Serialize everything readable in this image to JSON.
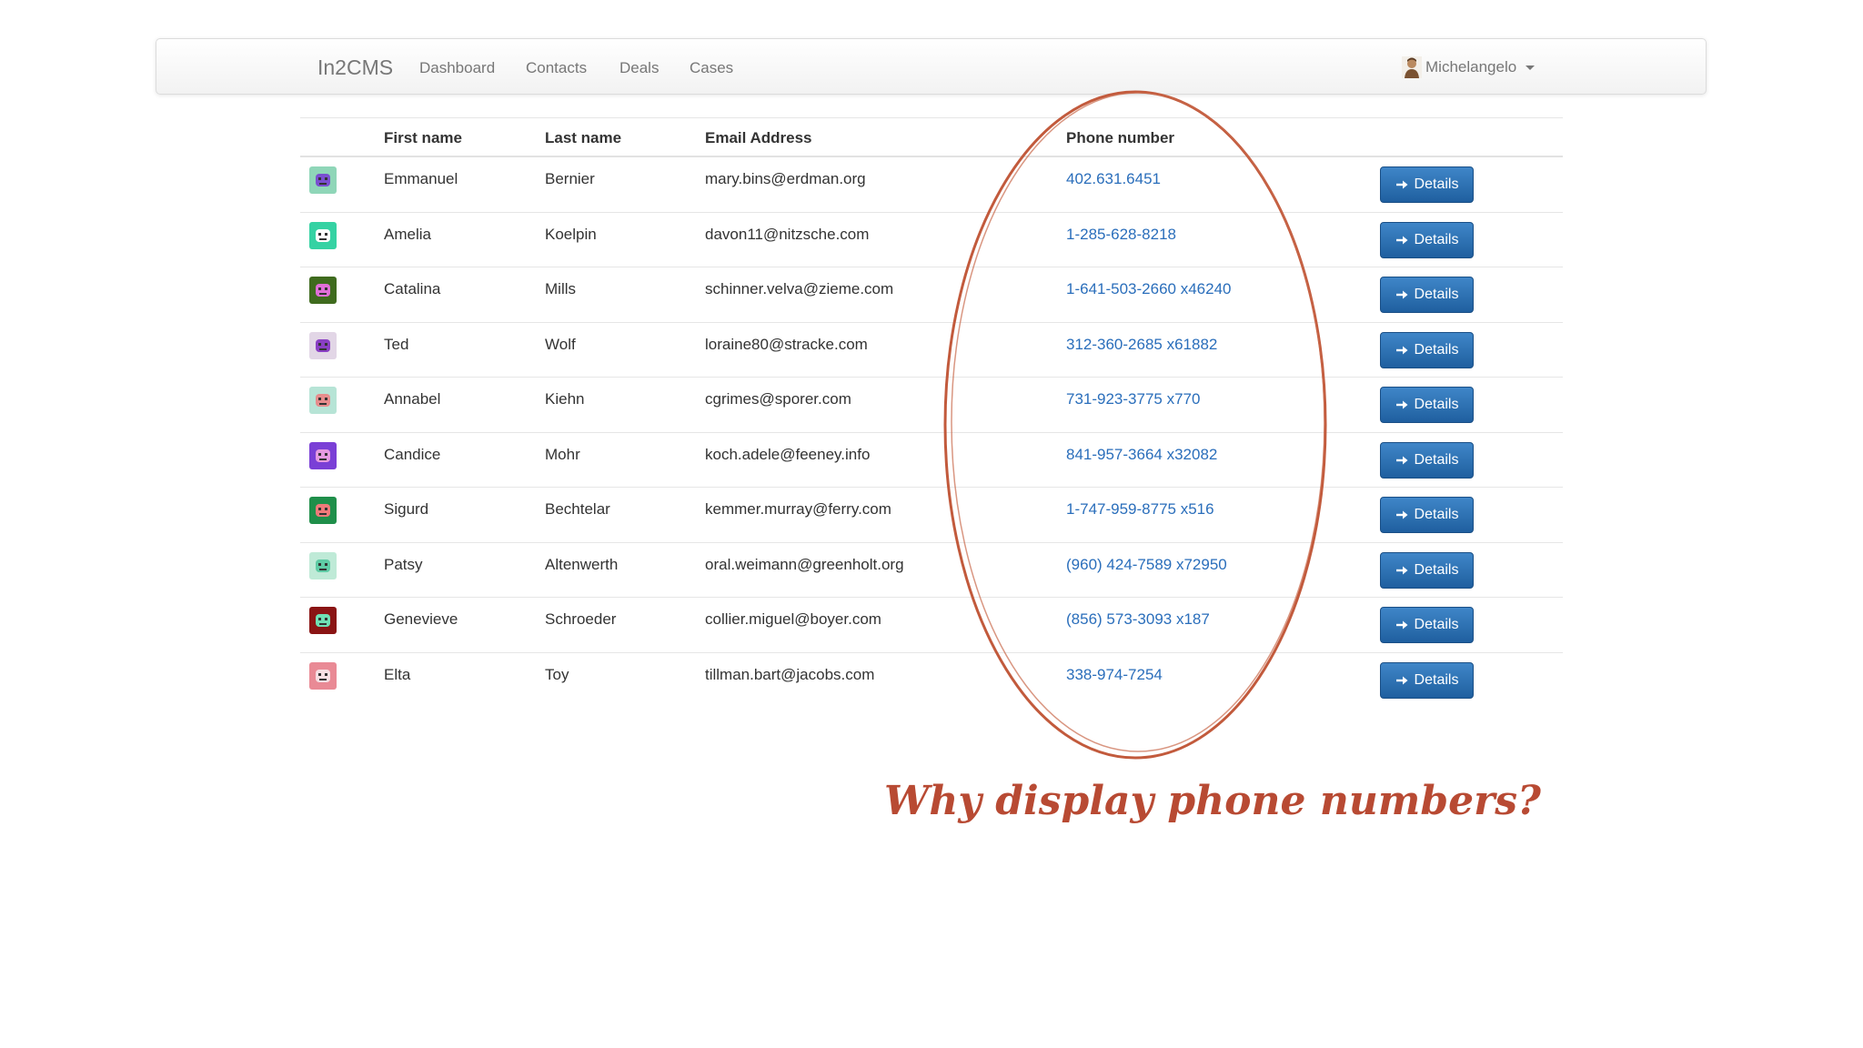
{
  "navbar": {
    "brand": "In2CMS",
    "links": [
      "Dashboard",
      "Contacts",
      "Deals",
      "Cases"
    ],
    "user": {
      "name": "Michelangelo",
      "avatar_icon": "user-avatar-icon",
      "menu_icon": "caret-down-icon"
    }
  },
  "table": {
    "headers": {
      "first_name": "First name",
      "last_name": "Last name",
      "email": "Email Address",
      "phone": "Phone number"
    },
    "details_label": "Details",
    "details_icon": "arrow-right-icon",
    "rows": [
      {
        "first": "Emmanuel",
        "last": "Bernier",
        "email": "mary.bins@erdman.org",
        "phone": "402.631.6451",
        "avatar_bg": "#8fd6b8",
        "avatar_fg": "#7a4fd0"
      },
      {
        "first": "Amelia",
        "last": "Koelpin",
        "email": "davon11@nitzsche.com",
        "phone": "1-285-628-8218",
        "avatar_bg": "#35d2a3",
        "avatar_fg": "#ffffff"
      },
      {
        "first": "Catalina",
        "last": "Mills",
        "email": "schinner.velva@zieme.com",
        "phone": "1-641-503-2660 x46240",
        "avatar_bg": "#3f6b1e",
        "avatar_fg": "#e06fd8"
      },
      {
        "first": "Ted",
        "last": "Wolf",
        "email": "loraine80@stracke.com",
        "phone": "312-360-2685 x61882",
        "avatar_bg": "#e2d6e6",
        "avatar_fg": "#8a3fc4"
      },
      {
        "first": "Annabel",
        "last": "Kiehn",
        "email": "cgrimes@sporer.com",
        "phone": "731-923-3775 x770",
        "avatar_bg": "#b7e4d6",
        "avatar_fg": "#e68d8d"
      },
      {
        "first": "Candice",
        "last": "Mohr",
        "email": "koch.adele@feeney.info",
        "phone": "841-957-3664 x32082",
        "avatar_bg": "#7a3fd6",
        "avatar_fg": "#e59ae0"
      },
      {
        "first": "Sigurd",
        "last": "Bechtelar",
        "email": "kemmer.murray@ferry.com",
        "phone": "1-747-959-8775 x516",
        "avatar_bg": "#1f8f4a",
        "avatar_fg": "#f07a7a"
      },
      {
        "first": "Patsy",
        "last": "Altenwerth",
        "email": "oral.weimann@greenholt.org",
        "phone": "(960) 424-7589 x72950",
        "avatar_bg": "#bfead7",
        "avatar_fg": "#5fcba5"
      },
      {
        "first": "Genevieve",
        "last": "Schroeder",
        "email": "collier.miguel@boyer.com",
        "phone": "(856) 573-3093 x187",
        "avatar_bg": "#8a1414",
        "avatar_fg": "#6fe0b4"
      },
      {
        "first": "Elta",
        "last": "Toy",
        "email": "tillman.bart@jacobs.com",
        "phone": "338-974-7254",
        "avatar_bg": "#e98a95",
        "avatar_fg": "#f6dfe3"
      }
    ]
  },
  "annotation": {
    "text": "Why display phone numbers?",
    "color": "#b84a33",
    "icon": "circle-annotation-icon"
  }
}
